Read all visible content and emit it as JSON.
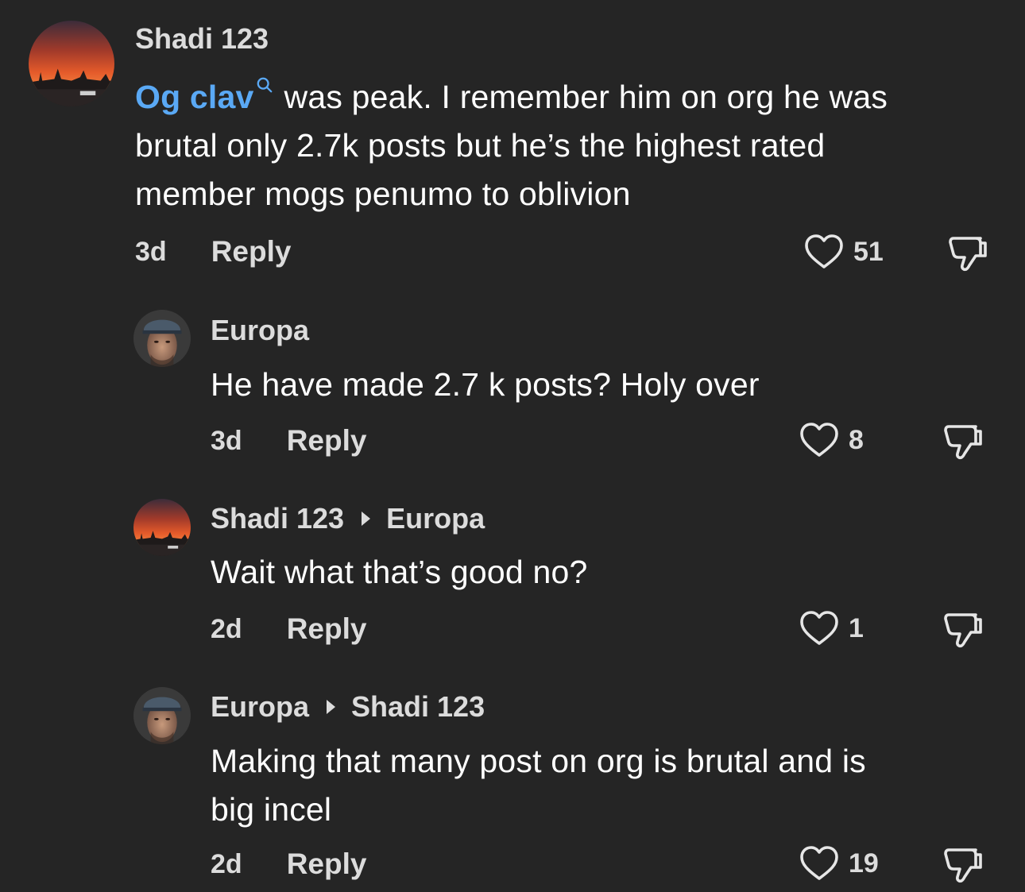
{
  "comments": [
    {
      "username": "Shadi 123",
      "mention": "Og clav",
      "text": "was peak. I remember him on org he was",
      "text_line2": "brutal only 2.7k posts but he’s the highest rated",
      "text_line3": "member mogs penumo to oblivion",
      "time": "3d",
      "reply_label": "Reply",
      "likes": "51"
    },
    {
      "username": "Europa",
      "text": "He have made 2.7 k posts? Holy over",
      "time": "3d",
      "reply_label": "Reply",
      "likes": "8"
    },
    {
      "username": "Shadi 123",
      "reply_to": "Europa",
      "text": "Wait what that’s good no?",
      "time": "2d",
      "reply_label": "Reply",
      "likes": "1"
    },
    {
      "username": "Europa",
      "reply_to": "Shadi 123",
      "text": "Making that many post on org is brutal and is",
      "text_line2": "big incel",
      "time": "2d",
      "reply_label": "Reply",
      "likes": "19"
    }
  ],
  "colors": {
    "background": "#252525",
    "mention": "#5aa9f5",
    "secondary_text": "#dcdcdc"
  },
  "icons": [
    "sunset-avatar",
    "portrait-avatar",
    "search-icon",
    "heart-icon",
    "thumbs-down-icon"
  ]
}
